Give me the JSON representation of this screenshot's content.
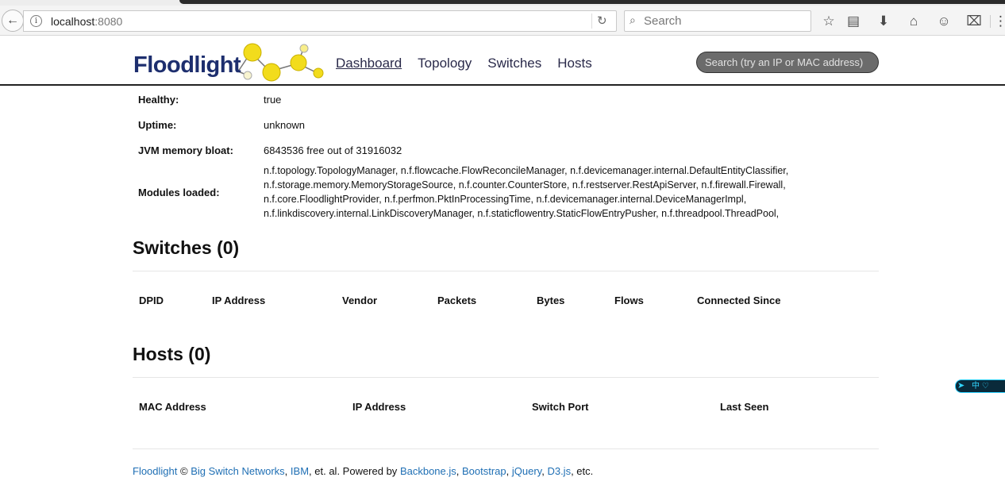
{
  "browser": {
    "url_host": "localhost",
    "url_port": ":8080",
    "search_placeholder": "Search",
    "icons": [
      "back-arrow-icon",
      "info-icon",
      "reload-icon",
      "search-icon",
      "bookmark-star-icon",
      "reading-list-icon",
      "download-icon",
      "home-icon",
      "chat-icon",
      "pocket-icon",
      "menu-icon"
    ]
  },
  "navbar": {
    "brand": "Floodlight",
    "links": [
      "Dashboard",
      "Topology",
      "Switches",
      "Hosts"
    ],
    "search_placeholder": "Search (try an IP or MAC address)"
  },
  "status": {
    "healthy_label": "Healthy:",
    "healthy_value": "true",
    "uptime_label": "Uptime:",
    "uptime_value": "unknown",
    "memory_label": "JVM memory bloat:",
    "memory_value": "6843536 free out of 31916032",
    "modules_label": "Modules loaded:",
    "modules_value": "n.f.topology.TopologyManager, n.f.flowcache.FlowReconcileManager, n.f.devicemanager.internal.DefaultEntityClassifier, n.f.storage.memory.MemoryStorageSource, n.f.counter.CounterStore, n.f.restserver.RestApiServer, n.f.firewall.Firewall, n.f.core.FloodlightProvider, n.f.perfmon.PktInProcessingTime, n.f.devicemanager.internal.DeviceManagerImpl, n.f.linkdiscovery.internal.LinkDiscoveryManager, n.f.staticflowentry.StaticFlowEntryPusher, n.f.threadpool.ThreadPool,"
  },
  "switches": {
    "title": "Switches (0)",
    "columns": [
      "DPID",
      "IP Address",
      "Vendor",
      "Packets",
      "Bytes",
      "Flows",
      "Connected Since"
    ]
  },
  "hosts": {
    "title": "Hosts (0)",
    "columns": [
      "MAC Address",
      "IP Address",
      "Switch Port",
      "Last Seen"
    ]
  },
  "footer": {
    "floodlight": "Floodlight",
    "copy": " © ",
    "bsn": "Big Switch Networks",
    "comma1": ", ",
    "ibm": "IBM",
    "mid": ", et. al. Powered by ",
    "backbone": "Backbone.js",
    "comma2": ", ",
    "bootstrap": "Bootstrap",
    "comma3": ", ",
    "jquery": "jQuery",
    "comma4": ", ",
    "d3": "D3.js",
    "end": ", etc."
  },
  "side_widget": {
    "text": "中 ♡"
  },
  "colors": {
    "brand": "#1d2e6e",
    "logo_ball": "#f2dc1c",
    "link": "#1f6fb4",
    "nav_search_bg": "#6b6b6b"
  }
}
